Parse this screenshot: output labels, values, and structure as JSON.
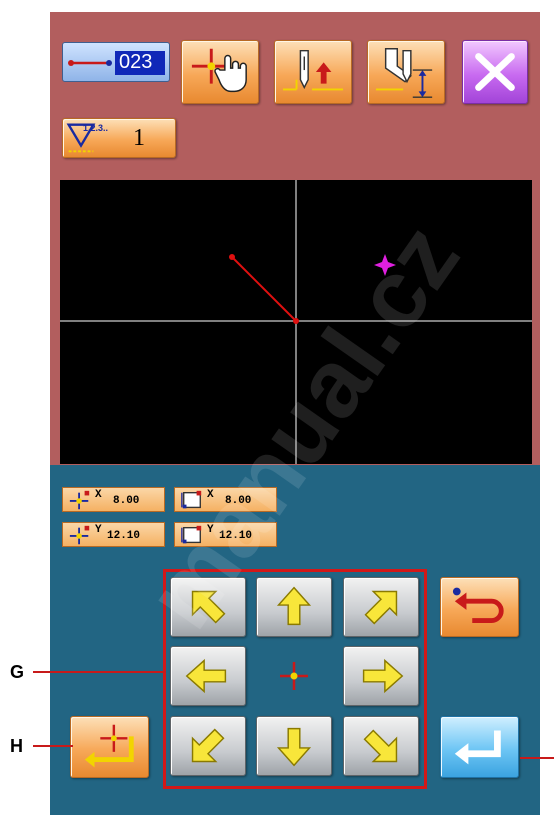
{
  "toolbar": {
    "stitch_length_value": "023",
    "stitch_length_icon": "stitch-length-icon",
    "select_point_icon": "crosshair-hand-icon",
    "needle_up_icon": "needle-up-icon",
    "presser_foot_icon": "presser-foot-icon",
    "close_icon": "close-icon"
  },
  "layer": {
    "icon": "layer-number-icon",
    "value": "1",
    "icon_text": "1.2.3.."
  },
  "display": {
    "background": "#000000",
    "grid_color": "#ffffff",
    "line_color": "#e01010",
    "marker_color": "#e020e0"
  },
  "coordinates": {
    "abs_x_label": "X",
    "abs_x_value": "8.00",
    "abs_y_label": "Y",
    "abs_y_value": "12.10",
    "rel_x_label": "X",
    "rel_x_value": "8.00",
    "rel_y_label": "Y",
    "rel_y_value": "12.10"
  },
  "dpad": {
    "up_left": "arrow-up-left-icon",
    "up": "arrow-up-icon",
    "up_right": "arrow-up-right-icon",
    "left": "arrow-left-icon",
    "center": "crosshair-icon",
    "right": "arrow-right-icon",
    "down_left": "arrow-down-left-icon",
    "down": "arrow-down-icon",
    "down_right": "arrow-down-right-icon"
  },
  "actions": {
    "back_icon": "return-icon",
    "origin_icon": "return-to-origin-icon",
    "enter_icon": "enter-icon"
  },
  "callouts": {
    "g": "G",
    "h": "H"
  },
  "watermark": "manual.cz"
}
